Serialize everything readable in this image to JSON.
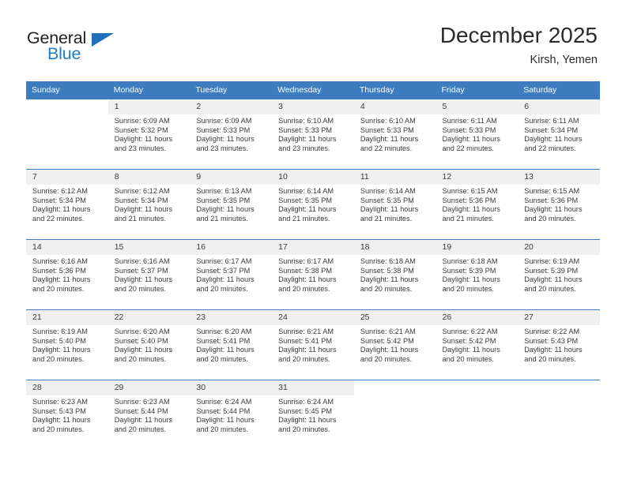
{
  "brand": {
    "name_part1": "General",
    "name_part2": "Blue",
    "accent_color": "#1f7dc4",
    "triangle_color": "#1f6fba"
  },
  "header": {
    "title": "December 2025",
    "subtitle": "Kirsh, Yemen"
  },
  "theme": {
    "header_row_bg": "#3c7cbf",
    "date_band_bg": "#f0f0f0",
    "text_color": "#3a3a3a"
  },
  "weekday_headers": [
    "Sunday",
    "Monday",
    "Tuesday",
    "Wednesday",
    "Thursday",
    "Friday",
    "Saturday"
  ],
  "weeks": [
    [
      {
        "day": "",
        "sunrise": "",
        "sunset": "",
        "daylight_line1": "",
        "daylight_line2": "",
        "empty": true
      },
      {
        "day": "1",
        "sunrise": "Sunrise: 6:09 AM",
        "sunset": "Sunset: 5:32 PM",
        "daylight_line1": "Daylight: 11 hours",
        "daylight_line2": "and 23 minutes."
      },
      {
        "day": "2",
        "sunrise": "Sunrise: 6:09 AM",
        "sunset": "Sunset: 5:33 PM",
        "daylight_line1": "Daylight: 11 hours",
        "daylight_line2": "and 23 minutes."
      },
      {
        "day": "3",
        "sunrise": "Sunrise: 6:10 AM",
        "sunset": "Sunset: 5:33 PM",
        "daylight_line1": "Daylight: 11 hours",
        "daylight_line2": "and 23 minutes."
      },
      {
        "day": "4",
        "sunrise": "Sunrise: 6:10 AM",
        "sunset": "Sunset: 5:33 PM",
        "daylight_line1": "Daylight: 11 hours",
        "daylight_line2": "and 22 minutes."
      },
      {
        "day": "5",
        "sunrise": "Sunrise: 6:11 AM",
        "sunset": "Sunset: 5:33 PM",
        "daylight_line1": "Daylight: 11 hours",
        "daylight_line2": "and 22 minutes."
      },
      {
        "day": "6",
        "sunrise": "Sunrise: 6:11 AM",
        "sunset": "Sunset: 5:34 PM",
        "daylight_line1": "Daylight: 11 hours",
        "daylight_line2": "and 22 minutes."
      }
    ],
    [
      {
        "day": "7",
        "sunrise": "Sunrise: 6:12 AM",
        "sunset": "Sunset: 5:34 PM",
        "daylight_line1": "Daylight: 11 hours",
        "daylight_line2": "and 22 minutes."
      },
      {
        "day": "8",
        "sunrise": "Sunrise: 6:12 AM",
        "sunset": "Sunset: 5:34 PM",
        "daylight_line1": "Daylight: 11 hours",
        "daylight_line2": "and 21 minutes."
      },
      {
        "day": "9",
        "sunrise": "Sunrise: 6:13 AM",
        "sunset": "Sunset: 5:35 PM",
        "daylight_line1": "Daylight: 11 hours",
        "daylight_line2": "and 21 minutes."
      },
      {
        "day": "10",
        "sunrise": "Sunrise: 6:14 AM",
        "sunset": "Sunset: 5:35 PM",
        "daylight_line1": "Daylight: 11 hours",
        "daylight_line2": "and 21 minutes."
      },
      {
        "day": "11",
        "sunrise": "Sunrise: 6:14 AM",
        "sunset": "Sunset: 5:35 PM",
        "daylight_line1": "Daylight: 11 hours",
        "daylight_line2": "and 21 minutes."
      },
      {
        "day": "12",
        "sunrise": "Sunrise: 6:15 AM",
        "sunset": "Sunset: 5:36 PM",
        "daylight_line1": "Daylight: 11 hours",
        "daylight_line2": "and 21 minutes."
      },
      {
        "day": "13",
        "sunrise": "Sunrise: 6:15 AM",
        "sunset": "Sunset: 5:36 PM",
        "daylight_line1": "Daylight: 11 hours",
        "daylight_line2": "and 20 minutes."
      }
    ],
    [
      {
        "day": "14",
        "sunrise": "Sunrise: 6:16 AM",
        "sunset": "Sunset: 5:36 PM",
        "daylight_line1": "Daylight: 11 hours",
        "daylight_line2": "and 20 minutes."
      },
      {
        "day": "15",
        "sunrise": "Sunrise: 6:16 AM",
        "sunset": "Sunset: 5:37 PM",
        "daylight_line1": "Daylight: 11 hours",
        "daylight_line2": "and 20 minutes."
      },
      {
        "day": "16",
        "sunrise": "Sunrise: 6:17 AM",
        "sunset": "Sunset: 5:37 PM",
        "daylight_line1": "Daylight: 11 hours",
        "daylight_line2": "and 20 minutes."
      },
      {
        "day": "17",
        "sunrise": "Sunrise: 6:17 AM",
        "sunset": "Sunset: 5:38 PM",
        "daylight_line1": "Daylight: 11 hours",
        "daylight_line2": "and 20 minutes."
      },
      {
        "day": "18",
        "sunrise": "Sunrise: 6:18 AM",
        "sunset": "Sunset: 5:38 PM",
        "daylight_line1": "Daylight: 11 hours",
        "daylight_line2": "and 20 minutes."
      },
      {
        "day": "19",
        "sunrise": "Sunrise: 6:18 AM",
        "sunset": "Sunset: 5:39 PM",
        "daylight_line1": "Daylight: 11 hours",
        "daylight_line2": "and 20 minutes."
      },
      {
        "day": "20",
        "sunrise": "Sunrise: 6:19 AM",
        "sunset": "Sunset: 5:39 PM",
        "daylight_line1": "Daylight: 11 hours",
        "daylight_line2": "and 20 minutes."
      }
    ],
    [
      {
        "day": "21",
        "sunrise": "Sunrise: 6:19 AM",
        "sunset": "Sunset: 5:40 PM",
        "daylight_line1": "Daylight: 11 hours",
        "daylight_line2": "and 20 minutes."
      },
      {
        "day": "22",
        "sunrise": "Sunrise: 6:20 AM",
        "sunset": "Sunset: 5:40 PM",
        "daylight_line1": "Daylight: 11 hours",
        "daylight_line2": "and 20 minutes."
      },
      {
        "day": "23",
        "sunrise": "Sunrise: 6:20 AM",
        "sunset": "Sunset: 5:41 PM",
        "daylight_line1": "Daylight: 11 hours",
        "daylight_line2": "and 20 minutes."
      },
      {
        "day": "24",
        "sunrise": "Sunrise: 6:21 AM",
        "sunset": "Sunset: 5:41 PM",
        "daylight_line1": "Daylight: 11 hours",
        "daylight_line2": "and 20 minutes."
      },
      {
        "day": "25",
        "sunrise": "Sunrise: 6:21 AM",
        "sunset": "Sunset: 5:42 PM",
        "daylight_line1": "Daylight: 11 hours",
        "daylight_line2": "and 20 minutes."
      },
      {
        "day": "26",
        "sunrise": "Sunrise: 6:22 AM",
        "sunset": "Sunset: 5:42 PM",
        "daylight_line1": "Daylight: 11 hours",
        "daylight_line2": "and 20 minutes."
      },
      {
        "day": "27",
        "sunrise": "Sunrise: 6:22 AM",
        "sunset": "Sunset: 5:43 PM",
        "daylight_line1": "Daylight: 11 hours",
        "daylight_line2": "and 20 minutes."
      }
    ],
    [
      {
        "day": "28",
        "sunrise": "Sunrise: 6:23 AM",
        "sunset": "Sunset: 5:43 PM",
        "daylight_line1": "Daylight: 11 hours",
        "daylight_line2": "and 20 minutes."
      },
      {
        "day": "29",
        "sunrise": "Sunrise: 6:23 AM",
        "sunset": "Sunset: 5:44 PM",
        "daylight_line1": "Daylight: 11 hours",
        "daylight_line2": "and 20 minutes."
      },
      {
        "day": "30",
        "sunrise": "Sunrise: 6:24 AM",
        "sunset": "Sunset: 5:44 PM",
        "daylight_line1": "Daylight: 11 hours",
        "daylight_line2": "and 20 minutes."
      },
      {
        "day": "31",
        "sunrise": "Sunrise: 6:24 AM",
        "sunset": "Sunset: 5:45 PM",
        "daylight_line1": "Daylight: 11 hours",
        "daylight_line2": "and 20 minutes."
      },
      {
        "day": "",
        "sunrise": "",
        "sunset": "",
        "daylight_line1": "",
        "daylight_line2": "",
        "empty": true
      },
      {
        "day": "",
        "sunrise": "",
        "sunset": "",
        "daylight_line1": "",
        "daylight_line2": "",
        "empty": true
      },
      {
        "day": "",
        "sunrise": "",
        "sunset": "",
        "daylight_line1": "",
        "daylight_line2": "",
        "empty": true
      }
    ]
  ]
}
